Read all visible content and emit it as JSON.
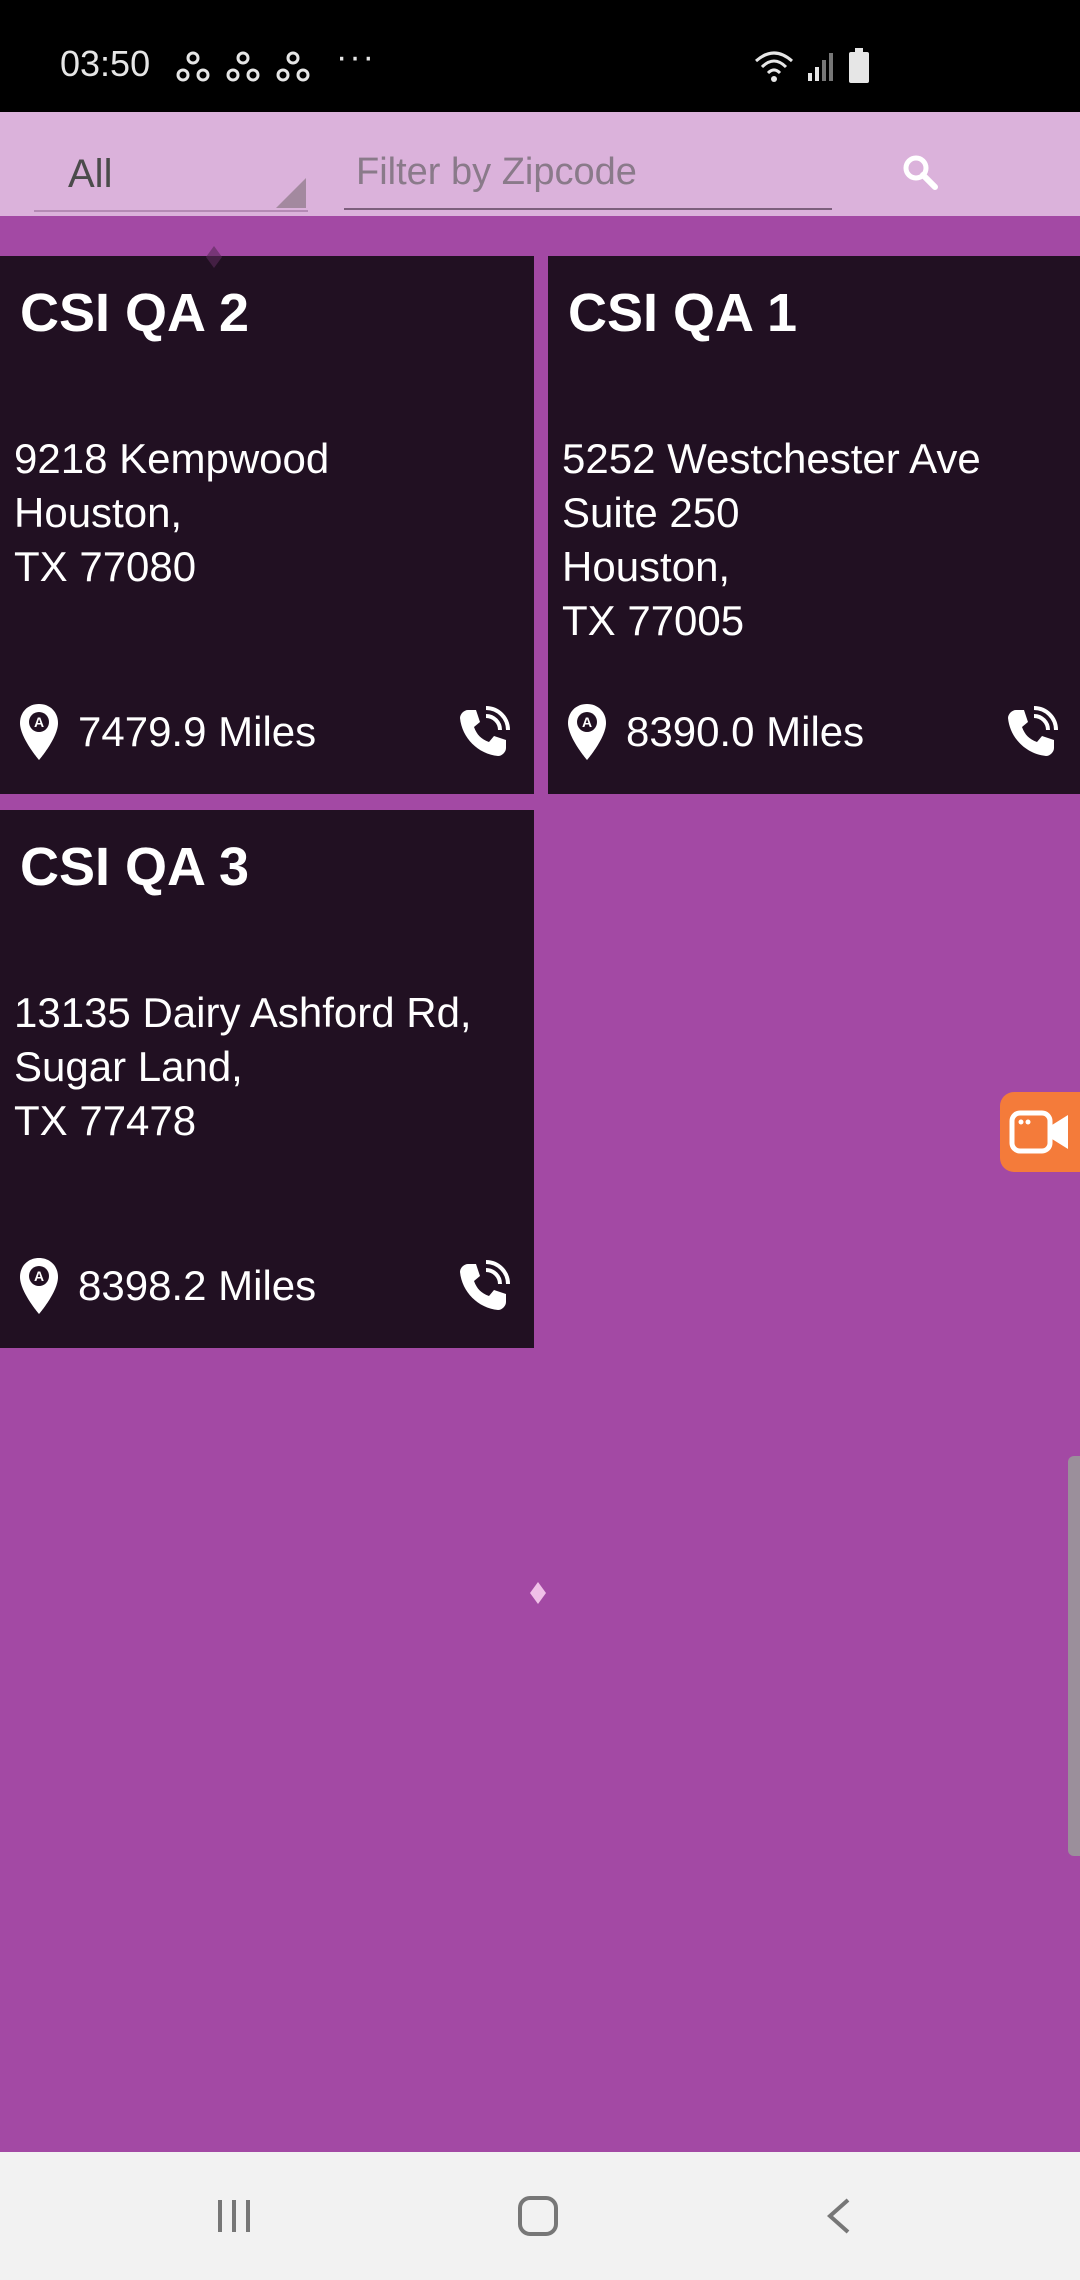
{
  "status_bar": {
    "time": "03:50",
    "more": "···",
    "notification_icons": [
      "share-icon",
      "share-icon",
      "share-icon"
    ]
  },
  "filter": {
    "category_selected": "All",
    "zip_placeholder": "Filter by Zipcode",
    "zip_value": ""
  },
  "locations": [
    {
      "name": "CSI QA 2",
      "address_lines": [
        "9218 Kempwood",
        "Houston,",
        "TX 77080"
      ],
      "distance": "7479.9 Miles"
    },
    {
      "name": "CSI QA 1",
      "address_lines": [
        "5252 Westchester Ave",
        "Suite 250",
        "Houston,",
        "TX 77005"
      ],
      "distance": "8390.0 Miles"
    },
    {
      "name": "CSI QA 3",
      "address_lines": [
        "13135 Dairy Ashford Rd,",
        "Sugar Land,",
        "TX 77478"
      ],
      "distance": "8398.2 Miles"
    }
  ],
  "colors": {
    "background": "#a349a4",
    "filter_bar": "#dbb2db",
    "card": "#211022",
    "recorder": "#f47b3a"
  },
  "icons": {
    "distance": "map-pin-icon",
    "phone": "phone-call-icon",
    "search": "search-icon",
    "recorder": "video-camera-icon"
  }
}
